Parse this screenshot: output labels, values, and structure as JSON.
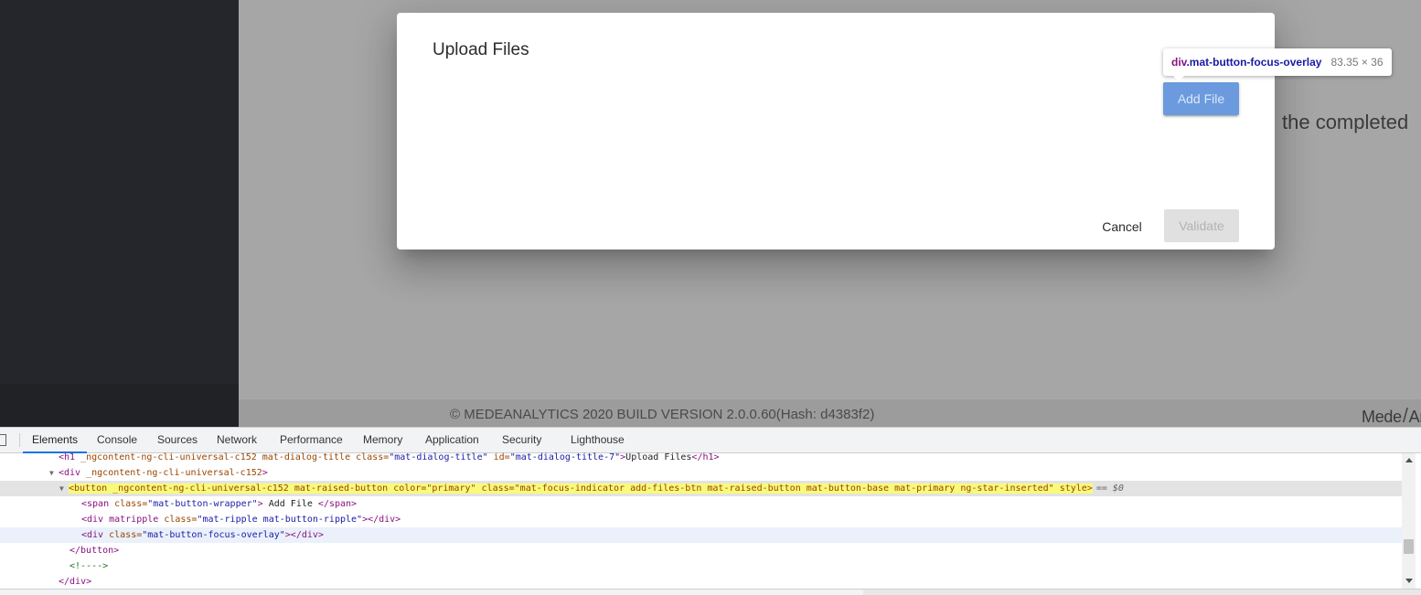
{
  "app": {
    "background_text": "the completed",
    "footer_text": "© MEDEANALYTICS 2020 BUILD VERSION 2.0.0.60(Hash: d4383f2)",
    "footer_logo_left": "Mede",
    "footer_logo_right": "An"
  },
  "dialog": {
    "title": "Upload Files",
    "add_file_label": "Add File",
    "cancel_label": "Cancel",
    "validate_label": "Validate"
  },
  "tooltip": {
    "tag": "div",
    "class_name": ".mat-button-focus-overlay",
    "dimensions": "83.35 × 36"
  },
  "devtools": {
    "tabs": [
      {
        "label": "Elements",
        "active": true
      },
      {
        "label": "Console"
      },
      {
        "label": "Sources"
      },
      {
        "label": "Network"
      },
      {
        "label": "Performance"
      },
      {
        "label": "Memory"
      },
      {
        "label": "Application"
      },
      {
        "label": "Security"
      },
      {
        "label": "Lighthouse"
      }
    ],
    "dom": {
      "h1_open": "<h1 ",
      "h1_attr1": "_ngcontent-ng-cli-universal-c152 mat-dialog-title ",
      "h1_attr2_name": "class=",
      "h1_attr2_val": "\"mat-dialog-title\"",
      "h1_attr3_name": " id=",
      "h1_attr3_val": "\"mat-dialog-title-7\"",
      "h1_text": "Upload Files",
      "h1_close": "</h1>",
      "div_open": "<div ",
      "div_attr": "_ngcontent-ng-cli-universal-c152",
      "div_end": ">",
      "button_line": "<button _ngcontent-ng-cli-universal-c152 mat-raised-button color=\"primary\" class=\"mat-focus-indicator add-files-btn mat-raised-button mat-button-base mat-primary ng-star-inserted\" style>",
      "button_eq": "== $0",
      "span_open": "<span ",
      "span_attr": "class=",
      "span_val": "\"mat-button-wrapper\"",
      "span_text": " Add File ",
      "span_close": "</span>",
      "ripple_open": "<div matripple ",
      "ripple_attr": "class=",
      "ripple_val": "\"mat-ripple mat-button-ripple\"",
      "ripple_close": "></div>",
      "overlay_open": "<div ",
      "overlay_attr": "class=",
      "overlay_val": "\"mat-button-focus-overlay\"",
      "overlay_close": "></div>",
      "button_close": "</button>",
      "comment": "<!---->",
      "div_close": "</div>"
    }
  }
}
